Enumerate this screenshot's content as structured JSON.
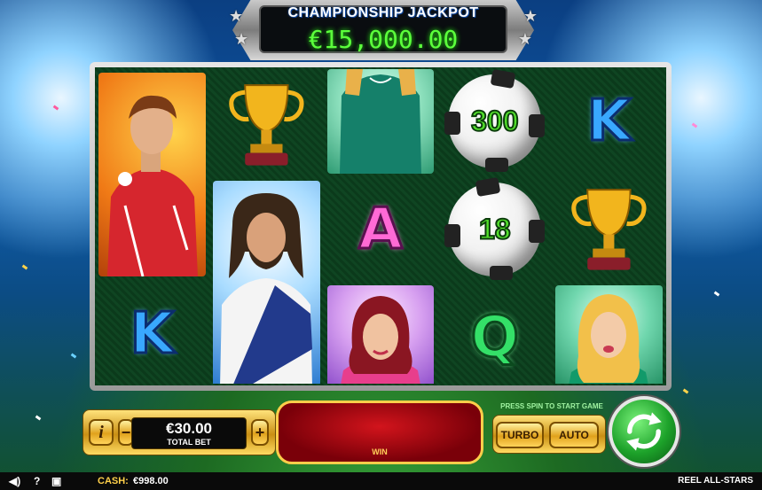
{
  "jackpot": {
    "title": "CHAMPIONSHIP JACKPOT",
    "amount": "€15,000.00"
  },
  "reels": [
    [
      {
        "symbol": "player-redshirt",
        "icon": "player-icon"
      },
      {
        "symbol": "K",
        "icon": "letter-k-icon"
      }
    ],
    [
      {
        "symbol": "trophy",
        "icon": "trophy-icon"
      },
      {
        "symbol": "player-longhair",
        "icon": "player-icon"
      }
    ],
    [
      {
        "symbol": "player-green",
        "icon": "player-icon"
      },
      {
        "symbol": "A",
        "icon": "letter-a-icon"
      },
      {
        "symbol": "player-woman-pink",
        "icon": "player-icon"
      }
    ],
    [
      {
        "symbol": "ball",
        "value": "300"
      },
      {
        "symbol": "ball",
        "value": "18"
      },
      {
        "symbol": "Q",
        "icon": "letter-q-icon"
      }
    ],
    [
      {
        "symbol": "K",
        "icon": "letter-k-icon"
      },
      {
        "symbol": "trophy",
        "icon": "trophy-icon"
      },
      {
        "symbol": "player-woman-blonde",
        "icon": "player-icon"
      }
    ]
  ],
  "controls": {
    "info_label": "i",
    "minus_label": "−",
    "plus_label": "+",
    "bet_amount": "€30.00",
    "bet_label": "TOTAL BET",
    "win_label": "WIN",
    "press_spin": "PRESS SPIN TO START GAME",
    "turbo_label": "TURBO",
    "auto_label": "AUTO"
  },
  "status": {
    "cash_label": "CASH:",
    "cash_value": "€998.00",
    "game_name": "REEL ALL-STARS"
  },
  "colors": {
    "jackpot_digits": "#5cff3c",
    "gold": "#e0a21c",
    "spin_green": "#1da22a",
    "win_red": "#b0101a"
  }
}
